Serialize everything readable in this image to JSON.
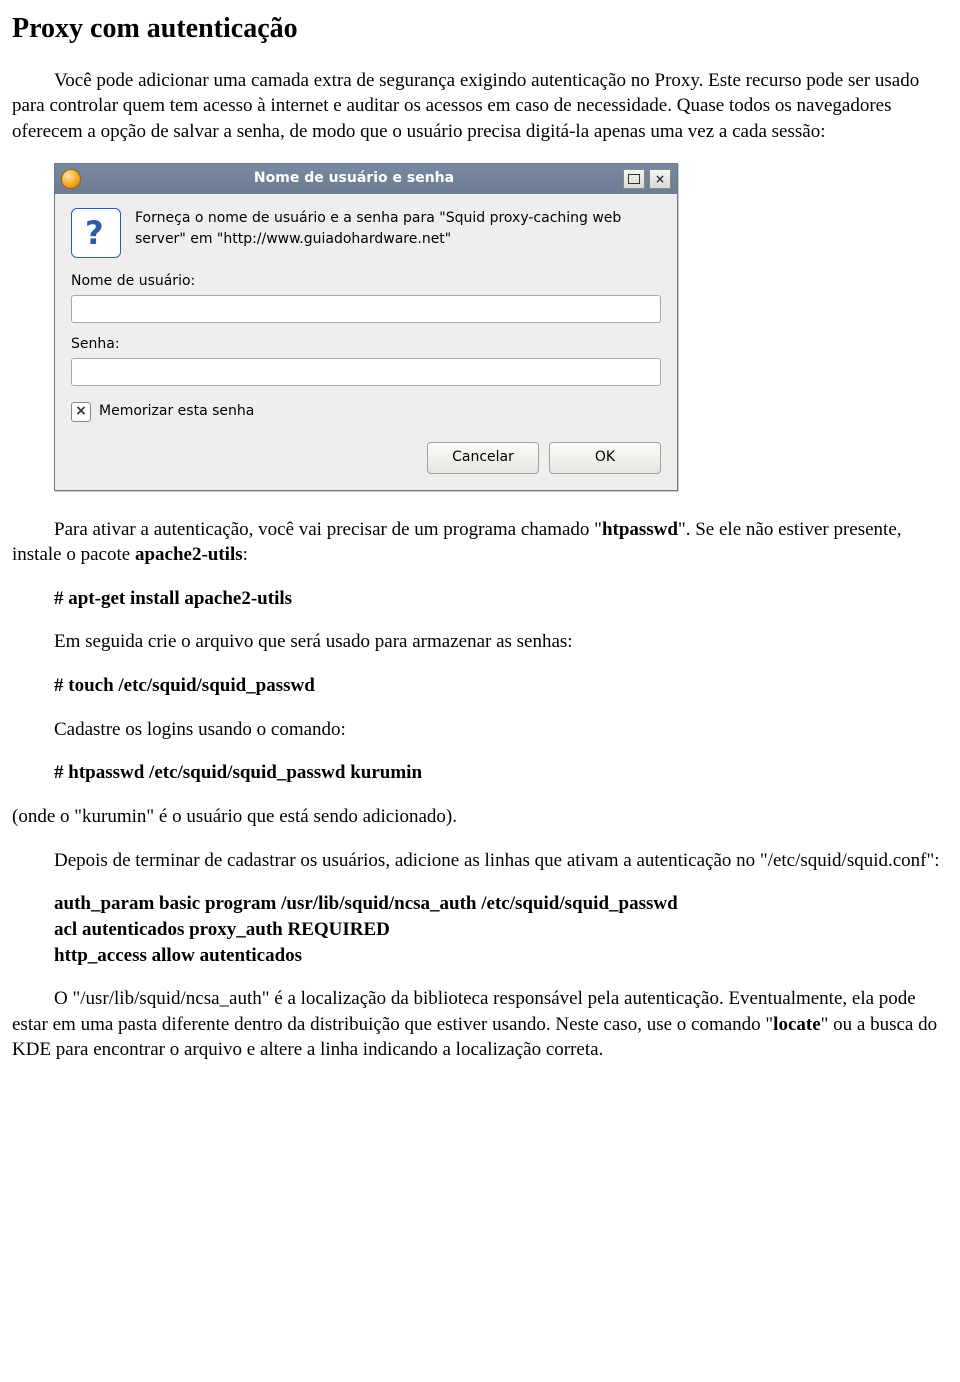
{
  "title": "Proxy com autenticação",
  "intro": "Você pode adicionar uma camada extra de segurança exigindo autenticação no Proxy. Este recurso pode ser usado para controlar quem tem acesso à internet e auditar os acessos em caso de necessidade. Quase todos os navegadores oferecem a opção de salvar a senha, de modo que o usuário precisa digitá-la apenas uma vez a cada sessão:",
  "dialog": {
    "title": "Nome de usuário e senha",
    "message": "Forneça o nome de usuário e a senha para \"Squid proxy-caching web server\" em \"http://www.guiadohardware.net\"",
    "user_label": "Nome de usuário:",
    "pass_label": "Senha:",
    "remember_label": "Memorizar esta senha",
    "remember_checked": true,
    "cancel": "Cancelar",
    "ok": "OK"
  },
  "p2": {
    "pre": "Para ativar a autenticação, você vai precisar de um programa chamado \"",
    "b1": "htpasswd",
    "mid": "\". Se ele não estiver presente, instale o pacote ",
    "b2": "apache2-utils",
    "post": ":"
  },
  "cmd1": "# apt-get install apache2-utils",
  "p3": "Em seguida crie o arquivo que será usado para armazenar as senhas:",
  "cmd2": "# touch /etc/squid/squid_passwd",
  "p4": "Cadastre os logins usando o comando:",
  "cmd3": "# htpasswd /etc/squid/squid_passwd kurumin",
  "p5": "(onde o \"kurumin\" é o usuário que está sendo adicionado).",
  "p6": "Depois de terminar de cadastrar os usuários, adicione as linhas que ativam a autenticação no \"/etc/squid/squid.conf\":",
  "conf1": "auth_param basic program /usr/lib/squid/ncsa_auth /etc/squid/squid_passwd",
  "conf2": "acl autenticados proxy_auth REQUIRED",
  "conf3": "http_access allow autenticados",
  "p7": {
    "pre": "O \"/usr/lib/squid/ncsa_auth\" é a localização da biblioteca responsável pela autenticação. Eventualmente, ela pode estar em uma pasta diferente dentro da distribuição que estiver usando. Neste caso, use o comando \"",
    "b1": "locate",
    "post": "\" ou a busca do KDE para encontrar o arquivo e altere a linha indicando a localização correta."
  }
}
